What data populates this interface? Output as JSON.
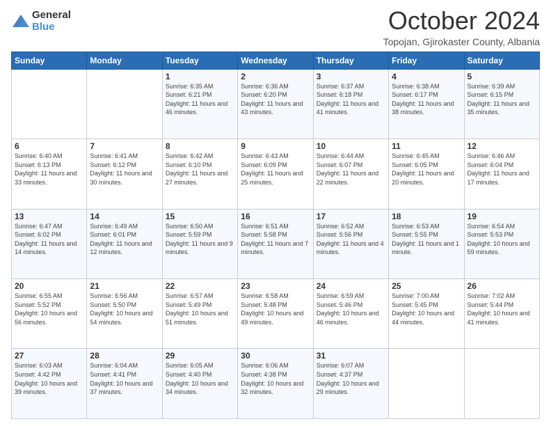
{
  "logo": {
    "general": "General",
    "blue": "Blue"
  },
  "header": {
    "month": "October 2024",
    "location": "Topojan, Gjirokaster County, Albania"
  },
  "weekdays": [
    "Sunday",
    "Monday",
    "Tuesday",
    "Wednesday",
    "Thursday",
    "Friday",
    "Saturday"
  ],
  "weeks": [
    [
      {
        "day": "",
        "sunrise": "",
        "sunset": "",
        "daylight": ""
      },
      {
        "day": "",
        "sunrise": "",
        "sunset": "",
        "daylight": ""
      },
      {
        "day": "1",
        "sunrise": "Sunrise: 6:35 AM",
        "sunset": "Sunset: 6:21 PM",
        "daylight": "Daylight: 11 hours and 46 minutes."
      },
      {
        "day": "2",
        "sunrise": "Sunrise: 6:36 AM",
        "sunset": "Sunset: 6:20 PM",
        "daylight": "Daylight: 11 hours and 43 minutes."
      },
      {
        "day": "3",
        "sunrise": "Sunrise: 6:37 AM",
        "sunset": "Sunset: 6:18 PM",
        "daylight": "Daylight: 11 hours and 41 minutes."
      },
      {
        "day": "4",
        "sunrise": "Sunrise: 6:38 AM",
        "sunset": "Sunset: 6:17 PM",
        "daylight": "Daylight: 11 hours and 38 minutes."
      },
      {
        "day": "5",
        "sunrise": "Sunrise: 6:39 AM",
        "sunset": "Sunset: 6:15 PM",
        "daylight": "Daylight: 11 hours and 35 minutes."
      }
    ],
    [
      {
        "day": "6",
        "sunrise": "Sunrise: 6:40 AM",
        "sunset": "Sunset: 6:13 PM",
        "daylight": "Daylight: 11 hours and 33 minutes."
      },
      {
        "day": "7",
        "sunrise": "Sunrise: 6:41 AM",
        "sunset": "Sunset: 6:12 PM",
        "daylight": "Daylight: 11 hours and 30 minutes."
      },
      {
        "day": "8",
        "sunrise": "Sunrise: 6:42 AM",
        "sunset": "Sunset: 6:10 PM",
        "daylight": "Daylight: 11 hours and 27 minutes."
      },
      {
        "day": "9",
        "sunrise": "Sunrise: 6:43 AM",
        "sunset": "Sunset: 6:09 PM",
        "daylight": "Daylight: 11 hours and 25 minutes."
      },
      {
        "day": "10",
        "sunrise": "Sunrise: 6:44 AM",
        "sunset": "Sunset: 6:07 PM",
        "daylight": "Daylight: 11 hours and 22 minutes."
      },
      {
        "day": "11",
        "sunrise": "Sunrise: 6:45 AM",
        "sunset": "Sunset: 6:05 PM",
        "daylight": "Daylight: 11 hours and 20 minutes."
      },
      {
        "day": "12",
        "sunrise": "Sunrise: 6:46 AM",
        "sunset": "Sunset: 6:04 PM",
        "daylight": "Daylight: 11 hours and 17 minutes."
      }
    ],
    [
      {
        "day": "13",
        "sunrise": "Sunrise: 6:47 AM",
        "sunset": "Sunset: 6:02 PM",
        "daylight": "Daylight: 11 hours and 14 minutes."
      },
      {
        "day": "14",
        "sunrise": "Sunrise: 6:49 AM",
        "sunset": "Sunset: 6:01 PM",
        "daylight": "Daylight: 11 hours and 12 minutes."
      },
      {
        "day": "15",
        "sunrise": "Sunrise: 6:50 AM",
        "sunset": "Sunset: 5:59 PM",
        "daylight": "Daylight: 11 hours and 9 minutes."
      },
      {
        "day": "16",
        "sunrise": "Sunrise: 6:51 AM",
        "sunset": "Sunset: 5:58 PM",
        "daylight": "Daylight: 11 hours and 7 minutes."
      },
      {
        "day": "17",
        "sunrise": "Sunrise: 6:52 AM",
        "sunset": "Sunset: 5:56 PM",
        "daylight": "Daylight: 11 hours and 4 minutes."
      },
      {
        "day": "18",
        "sunrise": "Sunrise: 6:53 AM",
        "sunset": "Sunset: 5:55 PM",
        "daylight": "Daylight: 11 hours and 1 minute."
      },
      {
        "day": "19",
        "sunrise": "Sunrise: 6:54 AM",
        "sunset": "Sunset: 5:53 PM",
        "daylight": "Daylight: 10 hours and 59 minutes."
      }
    ],
    [
      {
        "day": "20",
        "sunrise": "Sunrise: 6:55 AM",
        "sunset": "Sunset: 5:52 PM",
        "daylight": "Daylight: 10 hours and 56 minutes."
      },
      {
        "day": "21",
        "sunrise": "Sunrise: 6:56 AM",
        "sunset": "Sunset: 5:50 PM",
        "daylight": "Daylight: 10 hours and 54 minutes."
      },
      {
        "day": "22",
        "sunrise": "Sunrise: 6:57 AM",
        "sunset": "Sunset: 5:49 PM",
        "daylight": "Daylight: 10 hours and 51 minutes."
      },
      {
        "day": "23",
        "sunrise": "Sunrise: 6:58 AM",
        "sunset": "Sunset: 5:48 PM",
        "daylight": "Daylight: 10 hours and 49 minutes."
      },
      {
        "day": "24",
        "sunrise": "Sunrise: 6:59 AM",
        "sunset": "Sunset: 5:46 PM",
        "daylight": "Daylight: 10 hours and 46 minutes."
      },
      {
        "day": "25",
        "sunrise": "Sunrise: 7:00 AM",
        "sunset": "Sunset: 5:45 PM",
        "daylight": "Daylight: 10 hours and 44 minutes."
      },
      {
        "day": "26",
        "sunrise": "Sunrise: 7:02 AM",
        "sunset": "Sunset: 5:44 PM",
        "daylight": "Daylight: 10 hours and 41 minutes."
      }
    ],
    [
      {
        "day": "27",
        "sunrise": "Sunrise: 6:03 AM",
        "sunset": "Sunset: 4:42 PM",
        "daylight": "Daylight: 10 hours and 39 minutes."
      },
      {
        "day": "28",
        "sunrise": "Sunrise: 6:04 AM",
        "sunset": "Sunset: 4:41 PM",
        "daylight": "Daylight: 10 hours and 37 minutes."
      },
      {
        "day": "29",
        "sunrise": "Sunrise: 6:05 AM",
        "sunset": "Sunset: 4:40 PM",
        "daylight": "Daylight: 10 hours and 34 minutes."
      },
      {
        "day": "30",
        "sunrise": "Sunrise: 6:06 AM",
        "sunset": "Sunset: 4:38 PM",
        "daylight": "Daylight: 10 hours and 32 minutes."
      },
      {
        "day": "31",
        "sunrise": "Sunrise: 6:07 AM",
        "sunset": "Sunset: 4:37 PM",
        "daylight": "Daylight: 10 hours and 29 minutes."
      },
      {
        "day": "",
        "sunrise": "",
        "sunset": "",
        "daylight": ""
      },
      {
        "day": "",
        "sunrise": "",
        "sunset": "",
        "daylight": ""
      }
    ]
  ]
}
